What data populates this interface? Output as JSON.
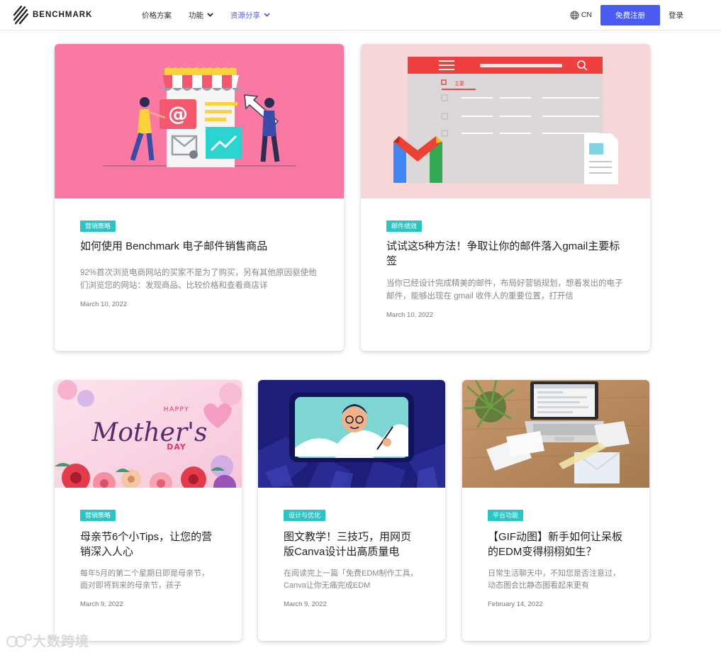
{
  "nav": {
    "brand": "BENCHMARK",
    "links": [
      {
        "label": "价格方案",
        "has_dropdown": false,
        "active": false
      },
      {
        "label": "功能",
        "has_dropdown": true,
        "active": false
      },
      {
        "label": "资源分享",
        "has_dropdown": true,
        "active": true
      }
    ],
    "language": "CN",
    "signup_label": "免费注册",
    "login_label": "登录",
    "accent_color": "#4a5cf0"
  },
  "cards": [
    {
      "tag": "营销策略",
      "title": "如何使用 Benchmark 电子邮件销售商品",
      "excerpt": "92%首次浏览电商网站的买家不是为了购买，另有其他原因驱使他们浏览您的网站：发现商品、比较价格和查看商店详",
      "date": "March 10, 2022",
      "image": "ecommerce-email-illustration"
    },
    {
      "tag": "邮件绩效",
      "title": "试试这5种方法！争取让你的邮件落入gmail主要标签",
      "excerpt": "当你已经设计完成精美的邮件，布局好营销规划，想着发出的电子邮件，能够出现在 gmail 收件人的重要位置，打开信",
      "date": "March 10, 2022",
      "image": "gmail-inbox-illustration",
      "image_inbox_label": "主要"
    },
    {
      "tag": "营销策略",
      "title": "母亲节6个小Tips，让您的营销深入人心",
      "excerpt": "每年5月的第二个星期日即是母亲节，面对即将到来的母亲节，孩子",
      "date": "March 9, 2022",
      "image": "happy-mothers-day-illustration",
      "image_text_top": "HAPPY",
      "image_text_script": "Mother's",
      "image_text_bottom": "DAY"
    },
    {
      "tag": "设计与优化",
      "title": "图文教学！三技巧，用网页版Canva设计出高质量电",
      "excerpt": "在阅读完上一篇「免费EDM制作工具，Canva让你无痛完成EDM",
      "date": "March 9, 2022",
      "image": "canva-design-illustration"
    },
    {
      "tag": "平台功能",
      "title": "【GIF动图】新手如何让呆板的EDM变得栩栩如生？",
      "excerpt": "日常生活聊天中，不知您是否注意过，动态图会比静态图看起来更有",
      "date": "February 14, 2022",
      "image": "laptop-desk-photo"
    }
  ],
  "watermark": "大数跨境",
  "colors": {
    "tag_bg": "#2bc3c3",
    "card1_bg": "#f979a3",
    "card2_bg": "#f7d6d7",
    "canva_bg": "#1e1d7a"
  }
}
